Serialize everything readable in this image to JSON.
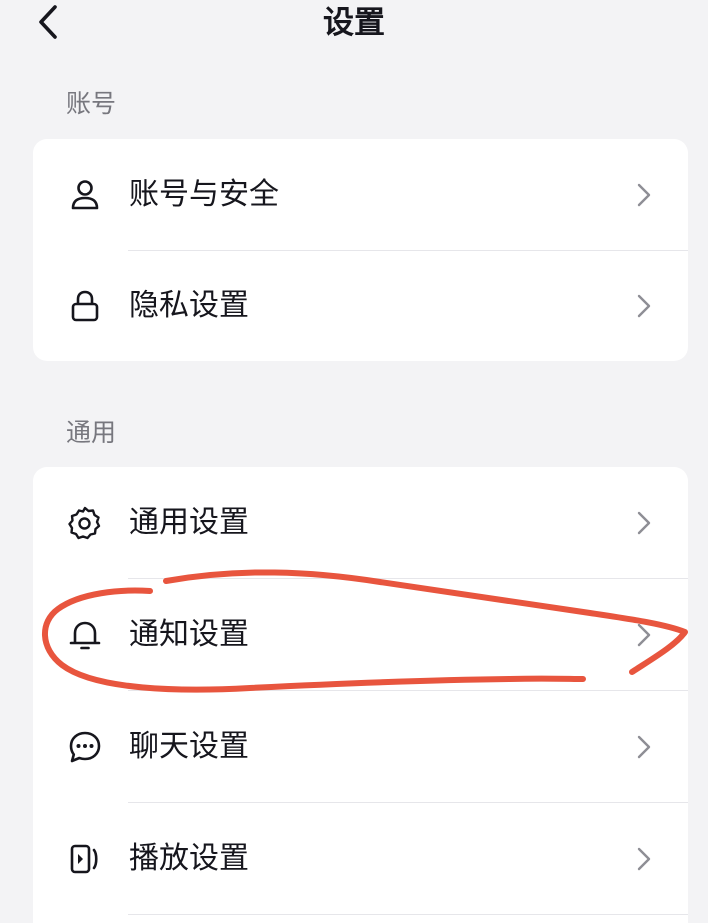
{
  "header": {
    "title": "设置",
    "back_icon": "chevron-left-icon"
  },
  "sections": [
    {
      "title": "账号",
      "items": [
        {
          "label": "账号与安全",
          "icon": "user-icon"
        },
        {
          "label": "隐私设置",
          "icon": "lock-icon"
        }
      ]
    },
    {
      "title": "通用",
      "items": [
        {
          "label": "通用设置",
          "icon": "gear-icon"
        },
        {
          "label": "通知设置",
          "icon": "bell-icon"
        },
        {
          "label": "聊天设置",
          "icon": "chat-bubble-icon"
        },
        {
          "label": "播放设置",
          "icon": "play-settings-icon"
        }
      ]
    }
  ],
  "chevron_icon": "chevron-right-icon",
  "annotation": {
    "type": "hand-drawn circle",
    "target": "通知设置",
    "color": "#e8553e"
  },
  "colors": {
    "background": "#f3f3f5",
    "card": "#ffffff",
    "text_primary": "#16161d",
    "text_secondary": "#77777e",
    "chevron": "#8e8e95",
    "annotation": "#e8553e"
  }
}
